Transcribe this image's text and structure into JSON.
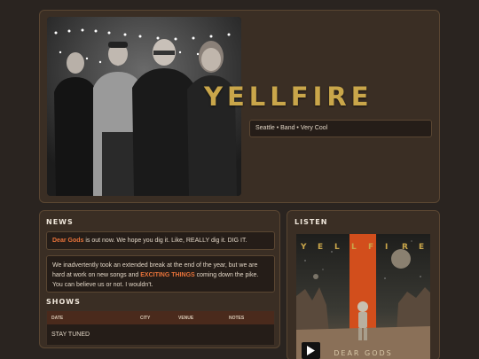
{
  "hero": {
    "band_name": "YELLFIRE",
    "tags": "Seattle • Band • Very Cool",
    "photo_alt": "Band photo"
  },
  "news": {
    "title": "NEWS",
    "items": [
      {
        "highlight": "Dear Gods",
        "text": " is out now. We hope you dig it. Like, REALLY dig it. DIG IT."
      },
      {
        "text_before": "We inadvertently took an extended break at the end of the year, but we are hard at work on new songs and ",
        "highlight": "EXCITING THINGS",
        "text_after": " coming down the pike. You can believe us or not. I wouldn't."
      }
    ]
  },
  "shows": {
    "title": "SHOWS",
    "columns": [
      "DATE",
      "CITY",
      "VENUE",
      "NOTES"
    ],
    "rows": [
      "STAY TUNED"
    ]
  },
  "listen": {
    "title": "LISTEN",
    "album_band_letters": [
      "Y",
      "E",
      "L",
      "L",
      "F",
      "I",
      "R",
      "E"
    ],
    "album_title": "DEAR GODS",
    "play_icon": "play-icon"
  },
  "colors": {
    "background": "#2a2420",
    "panel": "#3a2e24",
    "accent": "#e8733a",
    "title_gold": "#c9a64a"
  }
}
